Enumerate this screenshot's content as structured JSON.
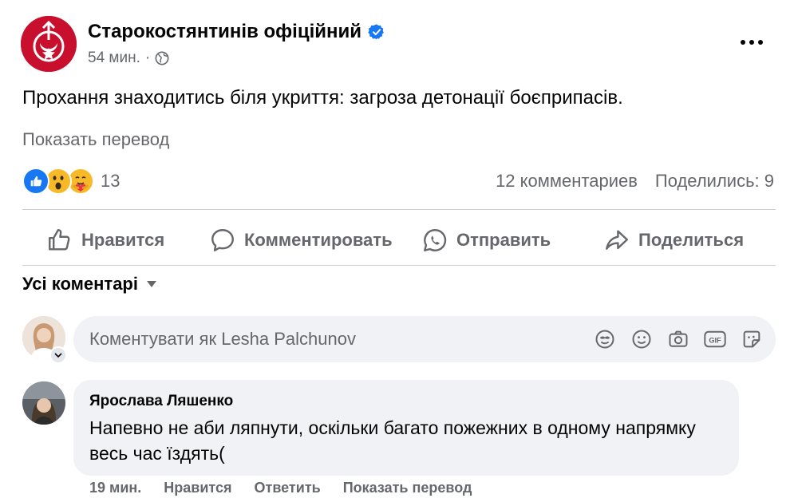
{
  "post": {
    "page_name": "Старокостянтинів офіційний",
    "time": "54 мин.",
    "separator": "·",
    "text": "Прохання знаходитись біля укриття: загроза детонації боєприпасів.",
    "translate_label": "Показать перевод",
    "reaction_count": "13",
    "comments_count": "12 комментариев",
    "shares_count": "Поделились: 9"
  },
  "actions": {
    "like": "Нравится",
    "comment": "Комментировать",
    "send": "Отправить",
    "share": "Поделиться"
  },
  "comments": {
    "filter_label": "Усі коментарі",
    "compose_placeholder": "Коментувати як Lesha Palchunov",
    "items": [
      {
        "author": "Ярослава Ляшенко",
        "text": "Напевно не аби ляпнути, оскільки багато пожежних в одному напрямку весь час їздять(",
        "time": "19 мин.",
        "like_label": "Нравится",
        "reply_label": "Ответить",
        "translate_label": "Показать перевод"
      }
    ]
  },
  "icons": {
    "reactions": [
      "like-reaction-icon",
      "wow-reaction-icon",
      "care-reaction-icon"
    ],
    "compose": [
      "avatar-sticker-icon",
      "emoji-icon",
      "camera-icon",
      "gif-icon",
      "sticker-icon"
    ]
  },
  "colors": {
    "brand_red": "#c8102e",
    "verified_blue": "#1877f2",
    "muted_text": "#65676b",
    "bubble_bg": "#f0f2f5"
  }
}
